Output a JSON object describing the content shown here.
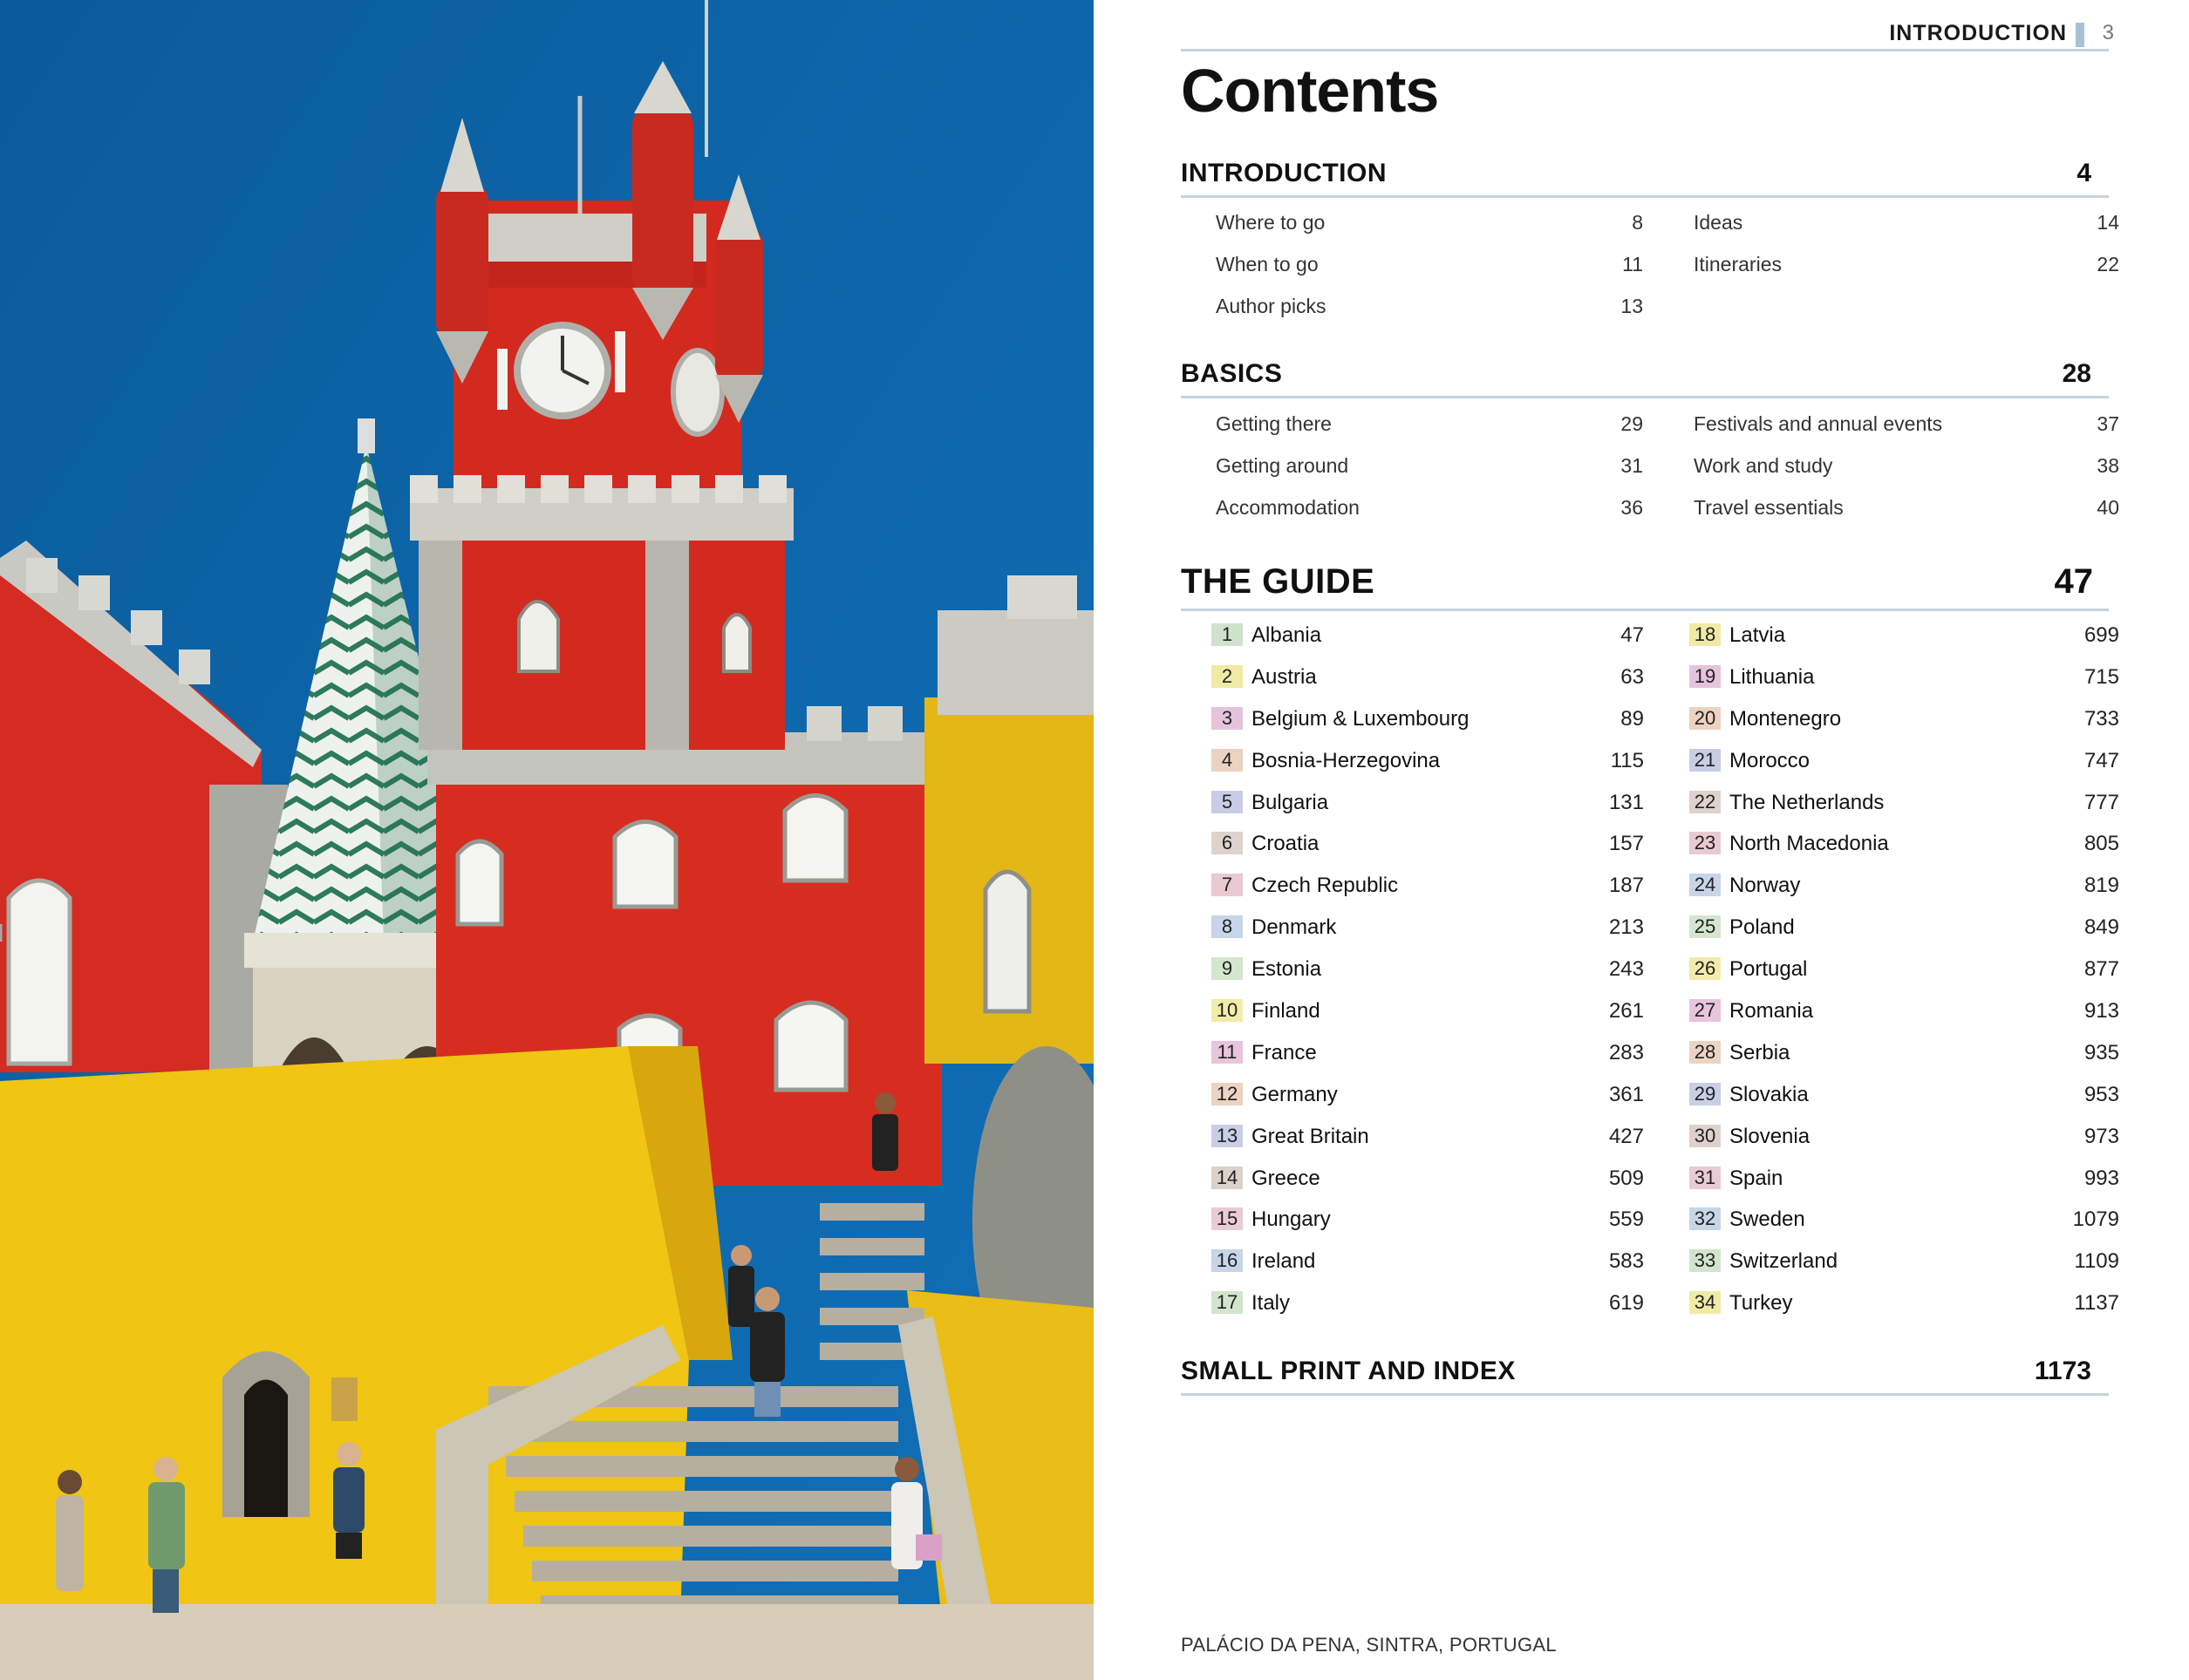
{
  "running_head": {
    "title": "INTRODUCTION",
    "page": "3"
  },
  "contents_title": "Contents",
  "sections": {
    "introduction": {
      "title": "INTRODUCTION",
      "page": "4",
      "left": [
        {
          "label": "Where to go",
          "page": "8"
        },
        {
          "label": "When to go",
          "page": "11"
        },
        {
          "label": "Author picks",
          "page": "13"
        }
      ],
      "right": [
        {
          "label": "Ideas",
          "page": "14"
        },
        {
          "label": "Itineraries",
          "page": "22"
        }
      ]
    },
    "basics": {
      "title": "BASICS",
      "page": "28",
      "left": [
        {
          "label": "Getting there",
          "page": "29"
        },
        {
          "label": "Getting around",
          "page": "31"
        },
        {
          "label": "Accommodation",
          "page": "36"
        }
      ],
      "right": [
        {
          "label": "Festivals and annual events",
          "page": "37"
        },
        {
          "label": "Work and study",
          "page": "38"
        },
        {
          "label": "Travel essentials",
          "page": "40"
        }
      ]
    },
    "guide": {
      "title": "THE GUIDE",
      "page": "47",
      "left": [
        {
          "num": "1",
          "label": "Albania",
          "page": "47",
          "color": "#cfe3cc"
        },
        {
          "num": "2",
          "label": "Austria",
          "page": "63",
          "color": "#f1eaa6"
        },
        {
          "num": "3",
          "label": "Belgium & Luxembourg",
          "page": "89",
          "color": "#e6c3dc"
        },
        {
          "num": "4",
          "label": "Bosnia-Herzegovina",
          "page": "115",
          "color": "#ecd2c1"
        },
        {
          "num": "5",
          "label": "Bulgaria",
          "page": "131",
          "color": "#c9cce6"
        },
        {
          "num": "6",
          "label": "Croatia",
          "page": "157",
          "color": "#ddd3cc"
        },
        {
          "num": "7",
          "label": "Czech Republic",
          "page": "187",
          "color": "#e9cad2"
        },
        {
          "num": "8",
          "label": "Denmark",
          "page": "213",
          "color": "#c8d4e8"
        },
        {
          "num": "9",
          "label": "Estonia",
          "page": "243",
          "color": "#d4e6cd"
        },
        {
          "num": "10",
          "label": "Finland",
          "page": "261",
          "color": "#f2ecaa"
        },
        {
          "num": "11",
          "label": "France",
          "page": "283",
          "color": "#e8c5dc"
        },
        {
          "num": "12",
          "label": "Germany",
          "page": "361",
          "color": "#ecd3c2"
        },
        {
          "num": "13",
          "label": "Great Britain",
          "page": "427",
          "color": "#c8cee6"
        },
        {
          "num": "14",
          "label": "Greece",
          "page": "509",
          "color": "#ddd2cb"
        },
        {
          "num": "15",
          "label": "Hungary",
          "page": "559",
          "color": "#eacbd3"
        },
        {
          "num": "16",
          "label": "Ireland",
          "page": "583",
          "color": "#c7d5e8"
        },
        {
          "num": "17",
          "label": "Italy",
          "page": "619",
          "color": "#d2e5cc"
        }
      ],
      "right": [
        {
          "num": "18",
          "label": "Latvia",
          "page": "699",
          "color": "#f1eaa6"
        },
        {
          "num": "19",
          "label": "Lithuania",
          "page": "715",
          "color": "#e6c3dc"
        },
        {
          "num": "20",
          "label": "Montenegro",
          "page": "733",
          "color": "#ecd2c1"
        },
        {
          "num": "21",
          "label": "Morocco",
          "page": "747",
          "color": "#c9cce6"
        },
        {
          "num": "22",
          "label": "The Netherlands",
          "page": "777",
          "color": "#ddd3cc"
        },
        {
          "num": "23",
          "label": "North Macedonia",
          "page": "805",
          "color": "#e9cad2"
        },
        {
          "num": "24",
          "label": "Norway",
          "page": "819",
          "color": "#c8d4e8"
        },
        {
          "num": "25",
          "label": "Poland",
          "page": "849",
          "color": "#d4e6cd"
        },
        {
          "num": "26",
          "label": "Portugal",
          "page": "877",
          "color": "#f2ecaa"
        },
        {
          "num": "27",
          "label": "Romania",
          "page": "913",
          "color": "#e8c5dc"
        },
        {
          "num": "28",
          "label": "Serbia",
          "page": "935",
          "color": "#ecd3c2"
        },
        {
          "num": "29",
          "label": "Slovakia",
          "page": "953",
          "color": "#c8cee6"
        },
        {
          "num": "30",
          "label": "Slovenia",
          "page": "973",
          "color": "#ddd2cb"
        },
        {
          "num": "31",
          "label": "Spain",
          "page": "993",
          "color": "#eacbd3"
        },
        {
          "num": "32",
          "label": "Sweden",
          "page": "1079",
          "color": "#c7d5e8"
        },
        {
          "num": "33",
          "label": "Switzerland",
          "page": "1109",
          "color": "#d2e5cc"
        },
        {
          "num": "34",
          "label": "Turkey",
          "page": "1137",
          "color": "#f1eaa6"
        }
      ]
    },
    "small_print": {
      "title": "SMALL PRINT AND INDEX",
      "page": "1173"
    }
  },
  "photo": {
    "icon": "palace-photo"
  },
  "caption": "PALÁCIO DA PENA, SINTRA, PORTUGAL"
}
